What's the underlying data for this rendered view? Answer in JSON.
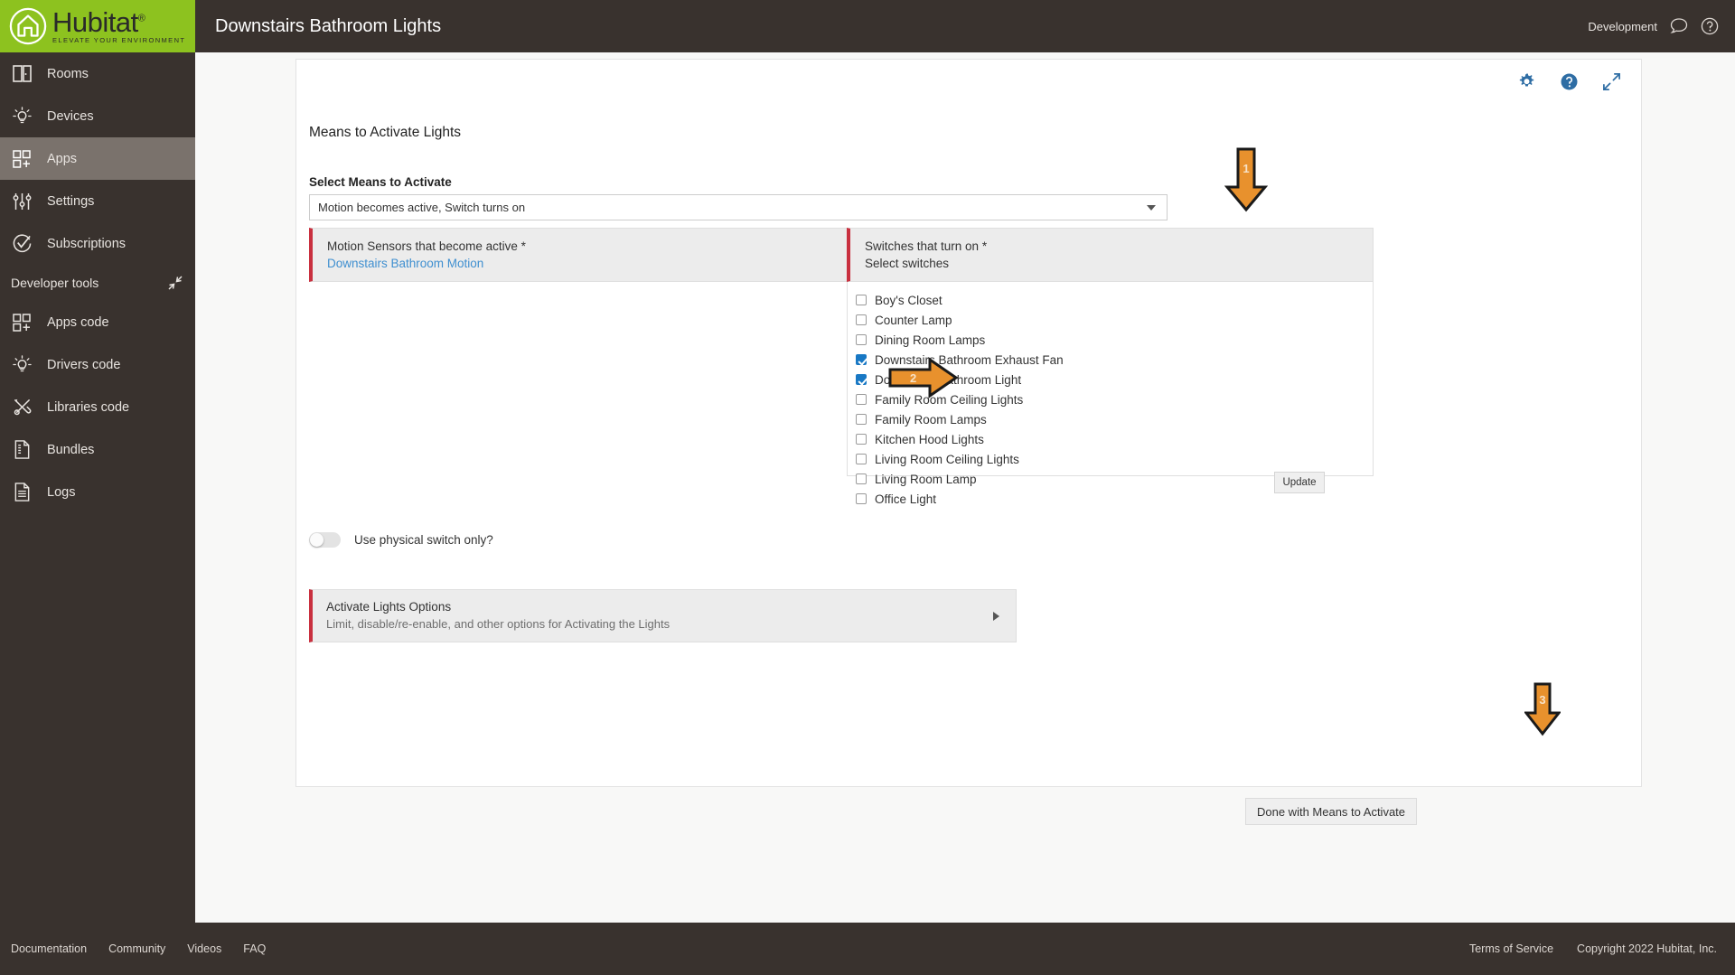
{
  "brand": {
    "name": "Hubitat",
    "trademark": "®",
    "tagline": "ELEVATE YOUR ENVIRONMENT"
  },
  "topbar": {
    "title": "Downstairs Bathroom Lights",
    "environment": "Development",
    "chat_icon": "chat-bubble-icon",
    "help_icon": "help-circle-icon"
  },
  "sidebar": {
    "items": [
      {
        "label": "Rooms",
        "icon": "rooms-icon",
        "active": false
      },
      {
        "label": "Devices",
        "icon": "lightbulb-icon",
        "active": false
      },
      {
        "label": "Apps",
        "icon": "apps-grid-icon",
        "active": true
      },
      {
        "label": "Settings",
        "icon": "sliders-icon",
        "active": false
      },
      {
        "label": "Subscriptions",
        "icon": "check-circle-icon",
        "active": false
      }
    ],
    "developer_tools": {
      "label": "Developer tools",
      "collapse_icon": "collapse-arrows-icon",
      "items": [
        {
          "label": "Apps code",
          "icon": "apps-grid-icon"
        },
        {
          "label": "Drivers code",
          "icon": "lightbulb-icon"
        },
        {
          "label": "Libraries code",
          "icon": "tools-icon"
        },
        {
          "label": "Bundles",
          "icon": "bundle-file-icon"
        },
        {
          "label": "Logs",
          "icon": "document-lines-icon"
        }
      ]
    }
  },
  "card": {
    "tools": [
      {
        "icon": "gear-icon",
        "color": "#2e6da4"
      },
      {
        "icon": "help-circle-icon",
        "color": "#2e6da4"
      },
      {
        "icon": "expand-arrows-icon",
        "color": "#2e6da4"
      }
    ],
    "section_title": "Means to Activate Lights",
    "select": {
      "label": "Select Means to Activate",
      "value": "Motion becomes active, Switch turns on",
      "caret_icon": "chevron-down-icon"
    },
    "motion_panel": {
      "title": "Motion Sensors that become active *",
      "selection": "Downstairs Bathroom Motion"
    },
    "switch_panel": {
      "title": "Switches that turn on *",
      "subtitle": "Select switches",
      "options": [
        {
          "label": "Boy's Closet",
          "checked": false
        },
        {
          "label": "Counter Lamp",
          "checked": false
        },
        {
          "label": "Dining Room Lamps",
          "checked": false
        },
        {
          "label": "Downstairs Bathroom Exhaust Fan",
          "checked": true
        },
        {
          "label": "Downstairs Bathroom Light",
          "checked": true
        },
        {
          "label": "Family Room Ceiling Lights",
          "checked": false
        },
        {
          "label": "Family Room Lamps",
          "checked": false
        },
        {
          "label": "Kitchen Hood Lights",
          "checked": false
        },
        {
          "label": "Living Room Ceiling Lights",
          "checked": false
        },
        {
          "label": "Living Room Lamp",
          "checked": false
        },
        {
          "label": "Office Light",
          "checked": false
        }
      ]
    },
    "update_button": "Update",
    "physical_switch_toggle": {
      "label": "Use physical switch only?",
      "state": "off"
    },
    "options_panel": {
      "title": "Activate Lights Options",
      "subtitle": "Limit, disable/re-enable, and other options for Activating the Lights",
      "caret_icon": "chevron-right-icon"
    },
    "done_button": "Done with Means to Activate"
  },
  "annotations": {
    "color": "#e8912d",
    "arrows": [
      {
        "number": "1",
        "direction": "down"
      },
      {
        "number": "2",
        "direction": "right"
      },
      {
        "number": "3",
        "direction": "down"
      }
    ]
  },
  "footer": {
    "links": [
      "Documentation",
      "Community",
      "Videos",
      "FAQ"
    ],
    "terms": "Terms of Service",
    "copyright": "Copyright 2022 Hubitat, Inc."
  }
}
